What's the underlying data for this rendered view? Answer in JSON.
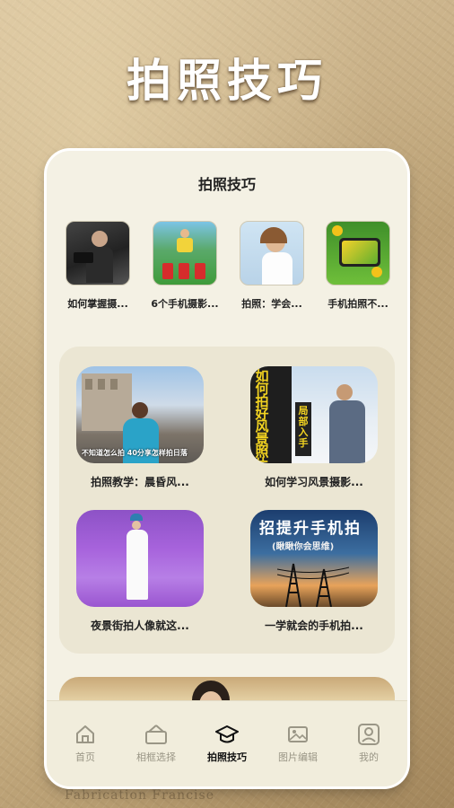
{
  "hero": {
    "title": "拍照技巧"
  },
  "card": {
    "title": "拍照技巧"
  },
  "top_items": [
    {
      "label": "如何掌握摄..."
    },
    {
      "label": "6个手机摄影..."
    },
    {
      "label": "拍照：学会..."
    },
    {
      "label": "手机拍照不..."
    }
  ],
  "videos": [
    {
      "label": "拍照教学：晨昏风...",
      "caption": "不知道怎么拍 40分享怎样拍日落"
    },
    {
      "label": "如何学习风景摄影...",
      "overlay_left": "如何拍好风景照片",
      "overlay_right": "局部入手"
    },
    {
      "label": "夜景街拍人像就这..."
    },
    {
      "label": "一学就会的手机拍...",
      "overlay_title": "招提升手机拍",
      "overlay_sub": "(瞅瞅你会思维)"
    }
  ],
  "tabs": [
    {
      "label": "首页",
      "icon": "home-icon"
    },
    {
      "label": "相框选择",
      "icon": "frame-icon"
    },
    {
      "label": "拍照技巧",
      "icon": "graduation-cap-icon"
    },
    {
      "label": "图片编辑",
      "icon": "image-edit-icon"
    },
    {
      "label": "我的",
      "icon": "user-icon"
    }
  ],
  "active_tab": "拍照技巧",
  "background": {
    "watermark": "Fabrication Francise"
  },
  "colors": {
    "card": "#f4f1e4",
    "panel": "#ebe6d3",
    "tab_active": "#111111",
    "tab_inactive": "#9a9686"
  }
}
